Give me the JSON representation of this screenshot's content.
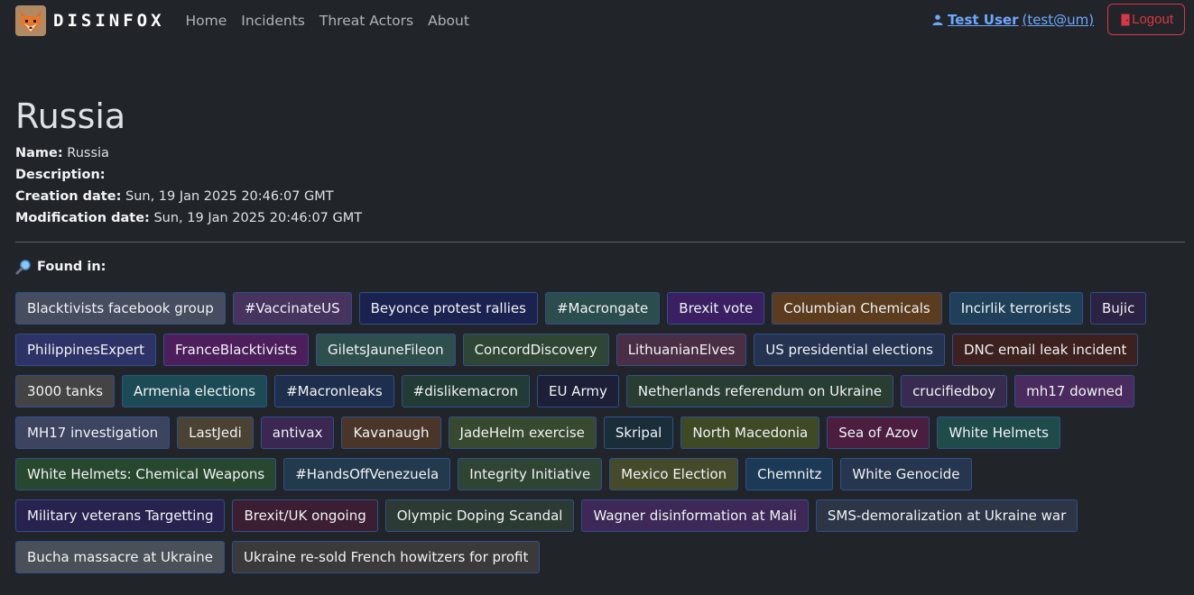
{
  "brand": {
    "name": "DISINFOX",
    "logo_icon": "fox-logo-icon"
  },
  "nav": {
    "items": [
      "Home",
      "Incidents",
      "Threat Actors",
      "About"
    ]
  },
  "user": {
    "name": "Test User",
    "email": "(test@um)",
    "icon": "person-icon"
  },
  "logout": {
    "label": "Logout",
    "icon": "door-icon"
  },
  "actor": {
    "title": "Russia",
    "name_label": "Name:",
    "name": "Russia",
    "description_label": "Description:",
    "description": "",
    "creation_label": "Creation date:",
    "creation": "Sun, 19 Jan 2025 20:46:07 GMT",
    "modification_label": "Modification date:",
    "modification": "Sun, 19 Jan 2025 20:46:07 GMT"
  },
  "found": {
    "label": "Found in:",
    "icon": "magnifying-glass-icon"
  },
  "incidents": [
    {
      "label": "Blacktivists facebook group",
      "color": "#454d5f"
    },
    {
      "label": "#VaccinateUS",
      "color": "#46335e"
    },
    {
      "label": "Beyonce protest rallies",
      "color": "#1b2250"
    },
    {
      "label": "#Macrongate",
      "color": "#2c4d4d"
    },
    {
      "label": "Brexit vote",
      "color": "#3a1f62"
    },
    {
      "label": "Columbian Chemicals",
      "color": "#5b3c1f"
    },
    {
      "label": "Incirlik terrorists",
      "color": "#1f4058"
    },
    {
      "label": "Bujic",
      "color": "#2c2244"
    },
    {
      "label": "PhilippinesExpert",
      "color": "#2d3366"
    },
    {
      "label": "FranceBlacktivists",
      "color": "#4c1e5c"
    },
    {
      "label": "GiletsJauneFileon",
      "color": "#2e4f4d"
    },
    {
      "label": "ConcordDiscovery",
      "color": "#2f4634"
    },
    {
      "label": "LithuanianElves",
      "color": "#4a2e45"
    },
    {
      "label": "US presidential elections",
      "color": "#253250"
    },
    {
      "label": "DNC email leak incident",
      "color": "#3c211e"
    },
    {
      "label": "3000 tanks",
      "color": "#444444"
    },
    {
      "label": "Armenia elections",
      "color": "#1d4b55"
    },
    {
      "label": "#Macronleaks",
      "color": "#1e2f4d"
    },
    {
      "label": "#dislikemacron",
      "color": "#223b35"
    },
    {
      "label": "EU Army",
      "color": "#1c1f36"
    },
    {
      "label": "Netherlands referendum on Ukraine",
      "color": "#2a3d33"
    },
    {
      "label": "crucifiedboy",
      "color": "#372c4f"
    },
    {
      "label": "mh17 downed",
      "color": "#4a2b5e"
    },
    {
      "label": "MH17 investigation",
      "color": "#3d4460"
    },
    {
      "label": "LastJedi",
      "color": "#4a4232"
    },
    {
      "label": "antivax",
      "color": "#3a2752"
    },
    {
      "label": "Kavanaugh",
      "color": "#4a3529"
    },
    {
      "label": "JadeHelm exercise",
      "color": "#37492e"
    },
    {
      "label": "Skripal",
      "color": "#1a2e3a"
    },
    {
      "label": "North Macedonia",
      "color": "#3d4a25"
    },
    {
      "label": "Sea of Azov",
      "color": "#4b1e40"
    },
    {
      "label": "White Helmets",
      "color": "#1f4b4b"
    },
    {
      "label": "White Helmets: Chemical Weapons",
      "color": "#27482e"
    },
    {
      "label": "#HandsOffVenezuela",
      "color": "#233a4d"
    },
    {
      "label": "Integrity Initiative",
      "color": "#2f4433"
    },
    {
      "label": "Mexico Election",
      "color": "#454a2a"
    },
    {
      "label": "Chemnitz",
      "color": "#1c3a55"
    },
    {
      "label": "White Genocide",
      "color": "#27364f"
    },
    {
      "label": "Military veterans Targetting",
      "color": "#28224f"
    },
    {
      "label": "Brexit/UK ongoing",
      "color": "#3c1e33"
    },
    {
      "label": "Olympic Doping Scandal",
      "color": "#2b3a33"
    },
    {
      "label": "Wagner disinformation at Mali",
      "color": "#3d2857"
    },
    {
      "label": "SMS-demoralization at Ukraine war",
      "color": "#2c3646"
    },
    {
      "label": "Bucha massacre at Ukraine",
      "color": "#4a5057"
    },
    {
      "label": "Ukraine re-sold French howitzers for profit",
      "color": "#3b3a3a"
    }
  ]
}
